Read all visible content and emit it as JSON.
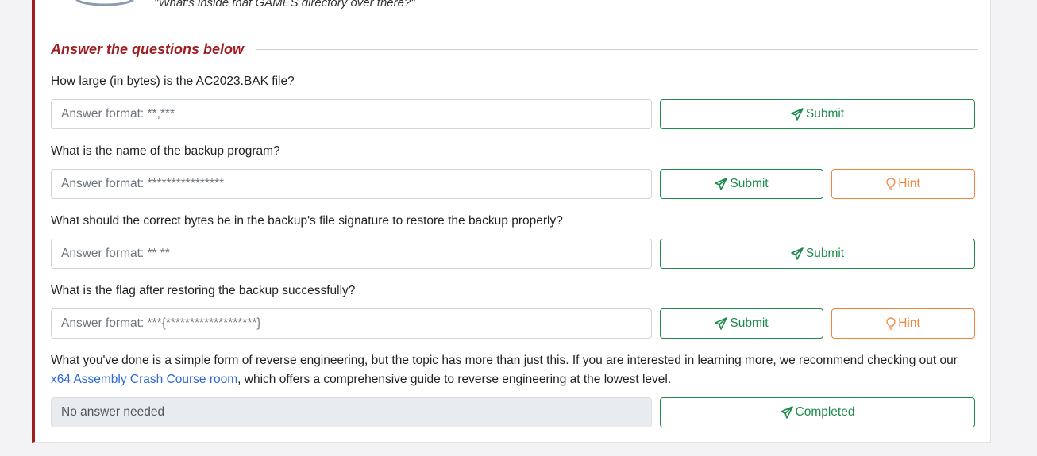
{
  "header": {
    "quote": "\"What's inside that GAMES directory over there?\""
  },
  "section": {
    "title": "Answer the questions below"
  },
  "questions": [
    {
      "text": "How large (in bytes) is the AC2023.BAK file?",
      "placeholder": "Answer format: **,***",
      "submit_label": "Submit"
    },
    {
      "text": "What is the name of the backup program?",
      "placeholder": "Answer format: ****************",
      "submit_label": "Submit",
      "hint_label": "Hint"
    },
    {
      "text": "What should the correct bytes be in the backup's file signature to restore the backup properly?",
      "placeholder": "Answer format: ** **",
      "submit_label": "Submit"
    },
    {
      "text": "What is the flag after restoring the backup successfully?",
      "placeholder": "Answer format: ***{*******************}",
      "submit_label": "Submit",
      "hint_label": "Hint"
    }
  ],
  "final": {
    "text_before": "What you've done is a simple form of reverse engineering, but the topic has more than just this. If you are interested in learning more, we recommend checking out our ",
    "link_text": "x64 Assembly Crash Course room",
    "text_after": ", which offers a comprehensive guide to reverse engineering at the lowest level.",
    "input_value": "No answer needed",
    "completed_label": "Completed"
  },
  "colors": {
    "accent": "#a01d22",
    "submit": "#1e8a4c",
    "hint": "#f0843a",
    "link": "#2f67d8"
  },
  "icons": {
    "submit": "paper-plane-icon",
    "hint": "lightbulb-icon"
  }
}
